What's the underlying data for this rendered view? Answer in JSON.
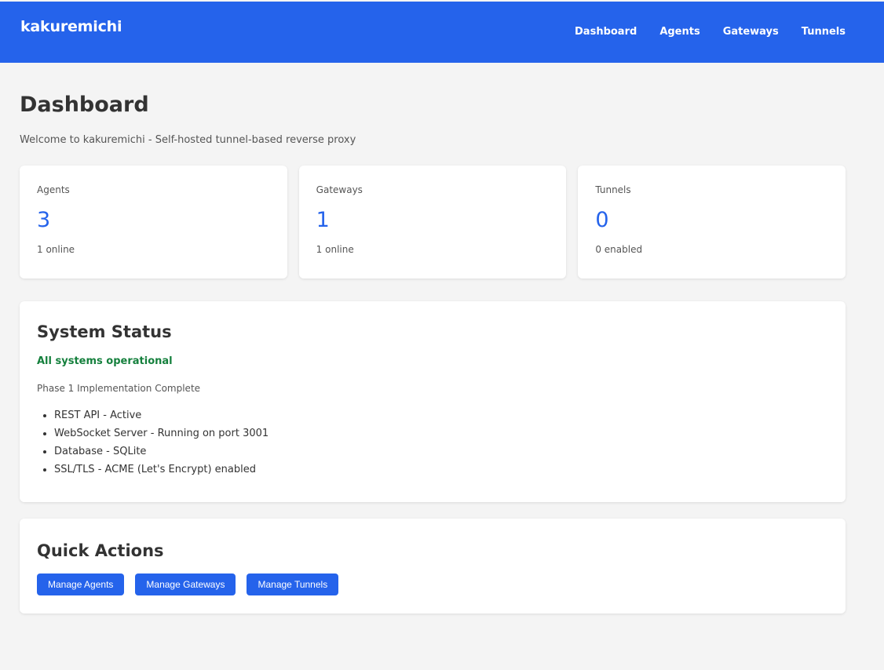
{
  "header": {
    "brand": "kakuremichi",
    "nav": [
      {
        "label": "Dashboard"
      },
      {
        "label": "Agents"
      },
      {
        "label": "Gateways"
      },
      {
        "label": "Tunnels"
      }
    ]
  },
  "page": {
    "title": "Dashboard",
    "subtitle": "Welcome to kakuremichi - Self-hosted tunnel-based reverse proxy"
  },
  "stats": [
    {
      "label": "Agents",
      "value": "3",
      "sub": "1 online"
    },
    {
      "label": "Gateways",
      "value": "1",
      "sub": "1 online"
    },
    {
      "label": "Tunnels",
      "value": "0",
      "sub": "0 enabled"
    }
  ],
  "system_status": {
    "title": "System Status",
    "status": "All systems operational",
    "phase": "Phase 1 Implementation Complete",
    "items": [
      "REST API - Active",
      "WebSocket Server - Running on port 3001",
      "Database - SQLite",
      "SSL/TLS - ACME (Let's Encrypt) enabled"
    ]
  },
  "quick_actions": {
    "title": "Quick Actions",
    "buttons": [
      {
        "label": "Manage Agents"
      },
      {
        "label": "Manage Gateways"
      },
      {
        "label": "Manage Tunnels"
      }
    ]
  },
  "colors": {
    "primary": "#2563eb",
    "success": "#15803d",
    "background": "#f4f4f4"
  }
}
